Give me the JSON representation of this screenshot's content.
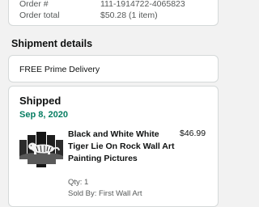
{
  "order": {
    "number_label": "Order #",
    "number_value": "111-1914722-4065823",
    "total_label": "Order total",
    "total_value": "$50.28 (1 item)"
  },
  "shipment": {
    "section_title": "Shipment details",
    "delivery_type": "FREE Prime Delivery",
    "status": "Shipped",
    "date": "Sep 8, 2020"
  },
  "item": {
    "title": "Black and White White Tiger Lie On Rock Wall Art Painting Pictures",
    "price": "$46.99",
    "qty": "Qty: 1",
    "seller": "Sold By: First Wall Art",
    "image_icon": "tiger-wall-art-thumbnail"
  },
  "colors": {
    "date_green": "#067d62",
    "border": "#d5d9d9",
    "background": "#f2f2f2"
  }
}
